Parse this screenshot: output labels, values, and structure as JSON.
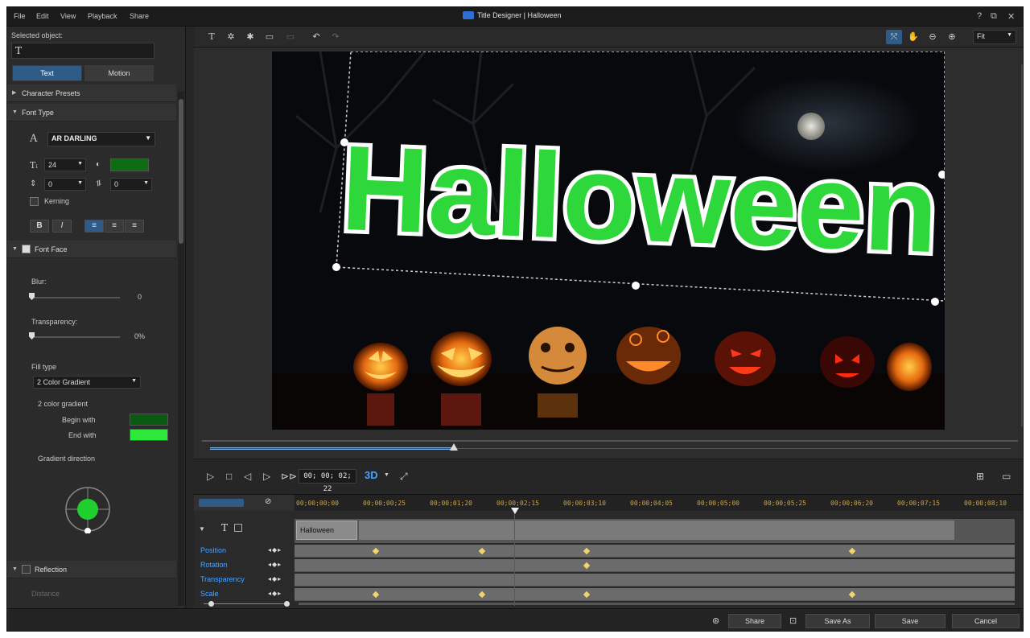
{
  "menu": [
    "File",
    "Edit",
    "View",
    "Playback",
    "Share"
  ],
  "window": {
    "title": "Title Designer  |  Halloween",
    "controls": [
      "?",
      "⧉",
      "✕"
    ]
  },
  "left_panel": {
    "selected_object_label": "Selected object:",
    "selected_object_icon": "T",
    "tabs": [
      "Text",
      "Motion"
    ],
    "character_presets": "Character Presets",
    "font_type": "Font Type",
    "font_name": "AR DARLING",
    "font_size": "24",
    "spacing_value": "0",
    "line_value": "0",
    "kerning": "Kerning",
    "bold": "B",
    "italic": "I",
    "font_face": "Font Face",
    "blur_label": "Blur:",
    "blur_value": "0",
    "transparency_label": "Transparency:",
    "transparency_value": "0%",
    "fill_type_label": "Fill type",
    "fill_type_value": "2 Color Gradient",
    "gradient_label": "2 color gradient",
    "begin_with": "Begin with",
    "end_with": "End with",
    "gradient_direction": "Gradient direction",
    "reflection": "Reflection",
    "distance": "Distance",
    "colors": {
      "font_color": "#0d6b12",
      "begin": "#0b5a12",
      "end": "#2ee83a"
    }
  },
  "toolbar": {
    "fit_label": "Fit"
  },
  "preview": {
    "title_text": "Halloween",
    "title_color": "#2fd83a"
  },
  "playback": {
    "timecode": "00; 00; 02; 22",
    "mode_3d": "3D"
  },
  "timeline": {
    "ruler": [
      "00;00;00;00",
      "00;00;00;25",
      "00;00;01;20",
      "00;00;02;15",
      "00;00;03;10",
      "00;00;04;05",
      "00;00;05;00",
      "00;00;05;25",
      "00;00;06;20",
      "00;00;07;15",
      "00;00;08;10"
    ],
    "clip_name": "Halloween",
    "tracks": [
      "Position",
      "Rotation",
      "Transparency",
      "Scale"
    ]
  },
  "buttons": {
    "share": "Share",
    "save_as": "Save As",
    "save": "Save",
    "cancel": "Cancel"
  }
}
